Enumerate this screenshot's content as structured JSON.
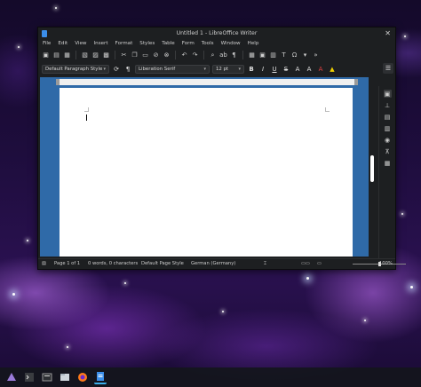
{
  "window": {
    "title": "Untitled 1 - LibreOffice Writer",
    "close_glyph": "✕"
  },
  "menubar": [
    "File",
    "Edit",
    "View",
    "Insert",
    "Format",
    "Styles",
    "Table",
    "Form",
    "Tools",
    "Window",
    "Help"
  ],
  "formatting": {
    "paragraph_style": "Default Paragraph Style",
    "font_name": "Liberation Serif",
    "font_size": "12 pt",
    "bold": "B",
    "italic": "I",
    "underline": "U",
    "strike": "S",
    "superscript": "A",
    "subscript": "A"
  },
  "statusbar": {
    "page": "Page 1 of 1",
    "words": "0 words, 0 characters",
    "page_style": "Default Page Style",
    "language": "German (Germany)",
    "zoom": "100%",
    "zoom_fraction": 0.5
  },
  "colors": {
    "accent": "#3daee9",
    "doc_bg": "#2f6aa8",
    "window_bg": "#1d1f21"
  },
  "taskbar": {
    "apps": [
      "app-launcher-icon",
      "terminal-icon",
      "system-monitor-icon",
      "file-manager-icon",
      "firefox-icon",
      "libreoffice-writer-icon"
    ]
  }
}
